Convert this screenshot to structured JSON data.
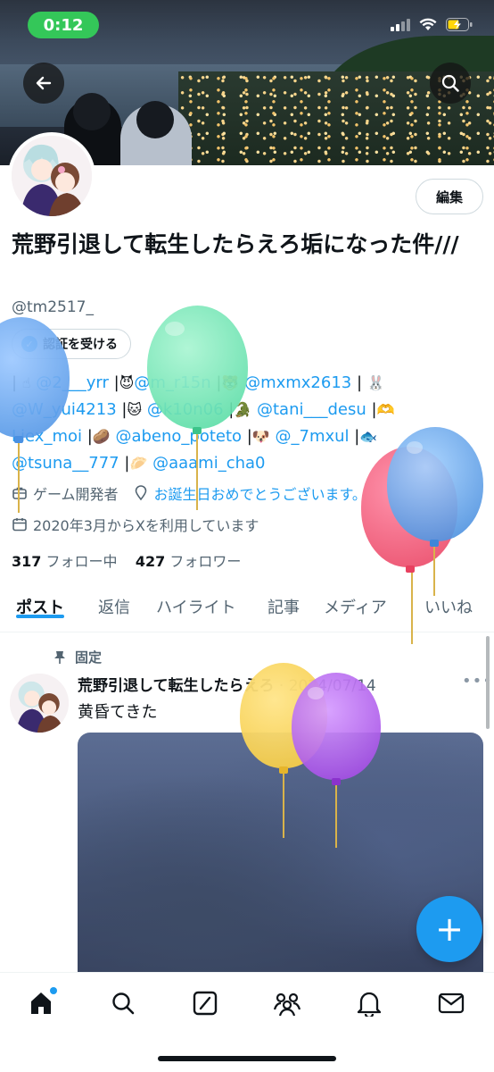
{
  "status_bar": {
    "time": "0:12"
  },
  "colors": {
    "accent": "#1d9bf0",
    "time_pill": "#34c759",
    "text_primary": "#0f1419",
    "text_secondary": "#536471"
  },
  "profile": {
    "edit_label": "編集",
    "display_name": "荒野引退して転生したらえろ垢になった件///",
    "handle": "@tm2517_",
    "verify_label": "認証を受ける",
    "bio": {
      "line1": [
        "@2___yrr",
        "@m_r15n",
        "@mxmx2613"
      ],
      "line2": [
        "@W_yui4213",
        "@k10n06",
        "@tani___desu"
      ],
      "line3": [
        "Liex_moi",
        "@abeno_poteto",
        "@_7mxul"
      ],
      "line4": [
        "@tsuna__777",
        "@aaami_cha0"
      ]
    },
    "job": "ゲーム開発者",
    "birthday": "お誕生日おめでとうございます。",
    "joined": "2020年3月からXを利用しています",
    "following_count": "317",
    "following_label": "フォロー中",
    "followers_count": "427",
    "followers_label": "フォロワー"
  },
  "tabs": [
    {
      "label": "ポスト",
      "active": true
    },
    {
      "label": "返信",
      "active": false
    },
    {
      "label": "ハイライト",
      "active": false
    },
    {
      "label": "記事",
      "active": false
    },
    {
      "label": "メディア",
      "active": false
    },
    {
      "label": "いいね",
      "active": false
    }
  ],
  "pinned_post": {
    "pinned_label": "固定",
    "author": "荒野引退して転生したらえろ",
    "date": "2024/07/14",
    "text": "黄昏てきた"
  },
  "fab_label": "+",
  "icons": [
    "back-arrow-icon",
    "search-icon",
    "home-icon",
    "grok-icon",
    "communities-icon",
    "bell-icon",
    "mail-icon",
    "pin-icon",
    "briefcase-icon",
    "location-icon",
    "calendar-icon"
  ]
}
